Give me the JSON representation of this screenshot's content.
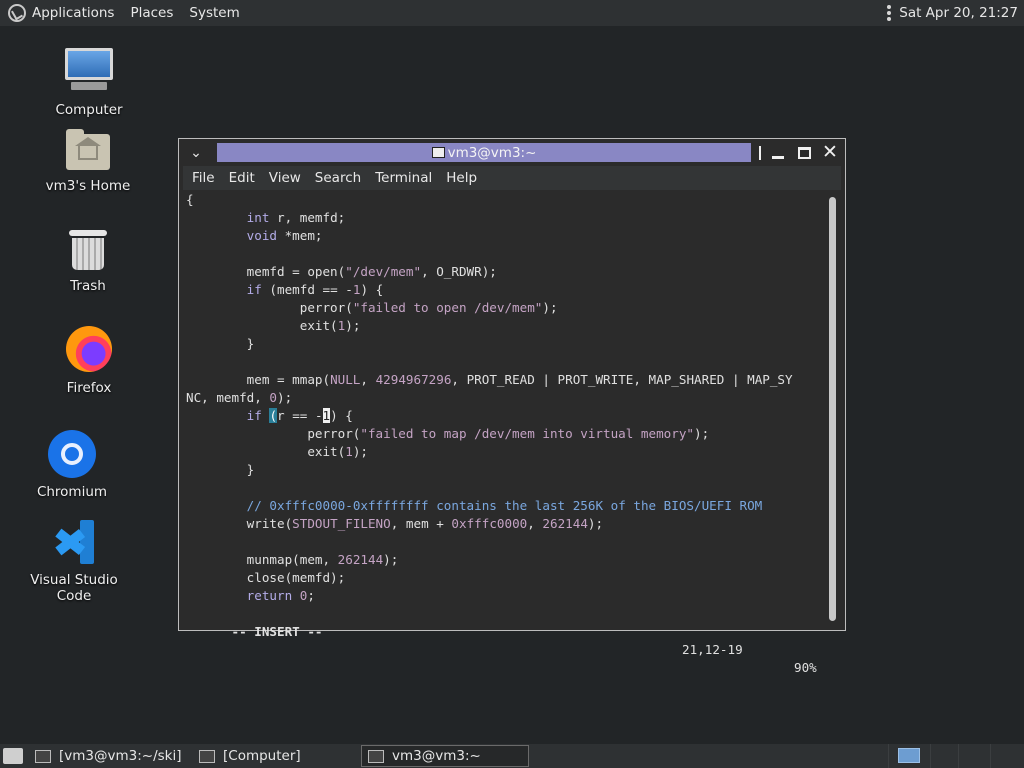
{
  "top_panel": {
    "applications": "Applications",
    "places": "Places",
    "system": "System",
    "clock": "Sat Apr 20, 21:27"
  },
  "desktop_icons": [
    {
      "label": "Computer",
      "icon": "computer-icon"
    },
    {
      "label": "vm3's Home",
      "icon": "home-folder-icon"
    },
    {
      "label": "Trash",
      "icon": "trash-icon"
    },
    {
      "label": "Firefox",
      "icon": "firefox-icon"
    },
    {
      "label": "Chromium",
      "icon": "chromium-icon"
    },
    {
      "label": "Visual Studio Code",
      "icon": "vscode-icon"
    }
  ],
  "terminal": {
    "title": "vm3@vm3:~",
    "menu": [
      "File",
      "Edit",
      "View",
      "Search",
      "Terminal",
      "Help"
    ],
    "status_mode": "-- INSERT --",
    "status_position": "21,12-19",
    "status_percent": "90%"
  },
  "taskbar": {
    "items": [
      {
        "label": "[vm3@vm3:~/ski]"
      },
      {
        "label": "[Computer]"
      },
      {
        "label": "vm3@vm3:~",
        "active": true
      }
    ]
  },
  "colors": {
    "desktop_bg": "#222527",
    "title_bar_accent": "#8987c4",
    "keyword": "#b3ace8",
    "string": "#c4a3c4",
    "comment": "#7aa7df"
  }
}
